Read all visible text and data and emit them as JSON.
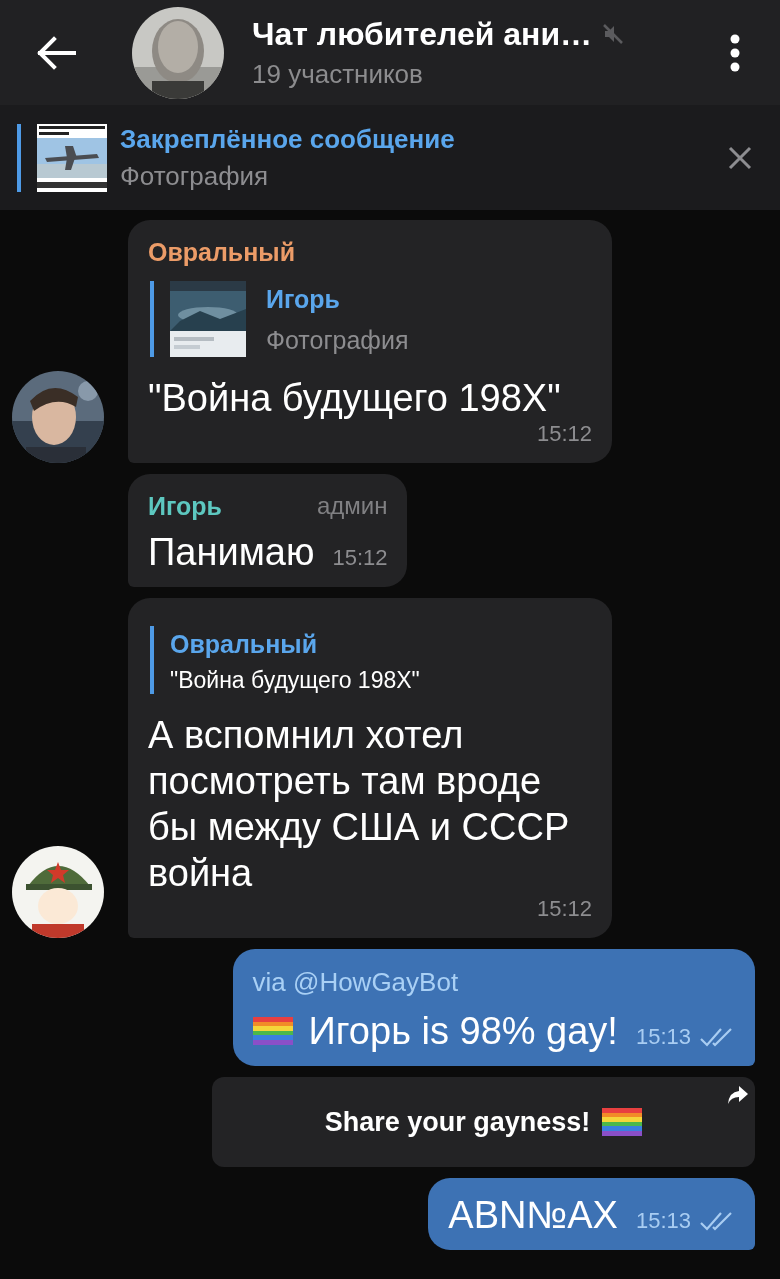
{
  "header": {
    "title": "Чат любителей ани…",
    "subtitle": "19 участников",
    "muted": true
  },
  "pinned": {
    "title": "Закреплённое сообщение",
    "text": "Фотография"
  },
  "messages": [
    {
      "kind": "incoming",
      "sender": "Овральный",
      "color": "#ec9c68",
      "reply": {
        "name": "Игорь",
        "text": "Фотография"
      },
      "text": "\"Война будущего 198X\"",
      "time": "15:12",
      "avatar": true
    },
    {
      "kind": "incoming",
      "sender": "Игорь",
      "color": "#5dc8c0",
      "badge": "админ",
      "text": "Панимаю",
      "time": "15:12",
      "avatar": false
    },
    {
      "kind": "incoming",
      "reply": {
        "kind": "text",
        "name": "Овральный",
        "text": "\"Война будущего 198X\""
      },
      "text": "А вспомнил хотел посмотреть там вроде бы между США и СССР война",
      "time": "15:12",
      "avatar": true
    },
    {
      "kind": "outgoing",
      "via": "via @HowGayBot",
      "rainbow_flag": true,
      "text": "Игорь is 98% gay!",
      "time": "15:13",
      "read": true
    },
    {
      "kind": "bot_button",
      "label": "Share your gayness!",
      "rainbow_flag": true
    },
    {
      "kind": "outgoing",
      "text": "ABN№AX",
      "time": "15:13",
      "read": true
    }
  ]
}
